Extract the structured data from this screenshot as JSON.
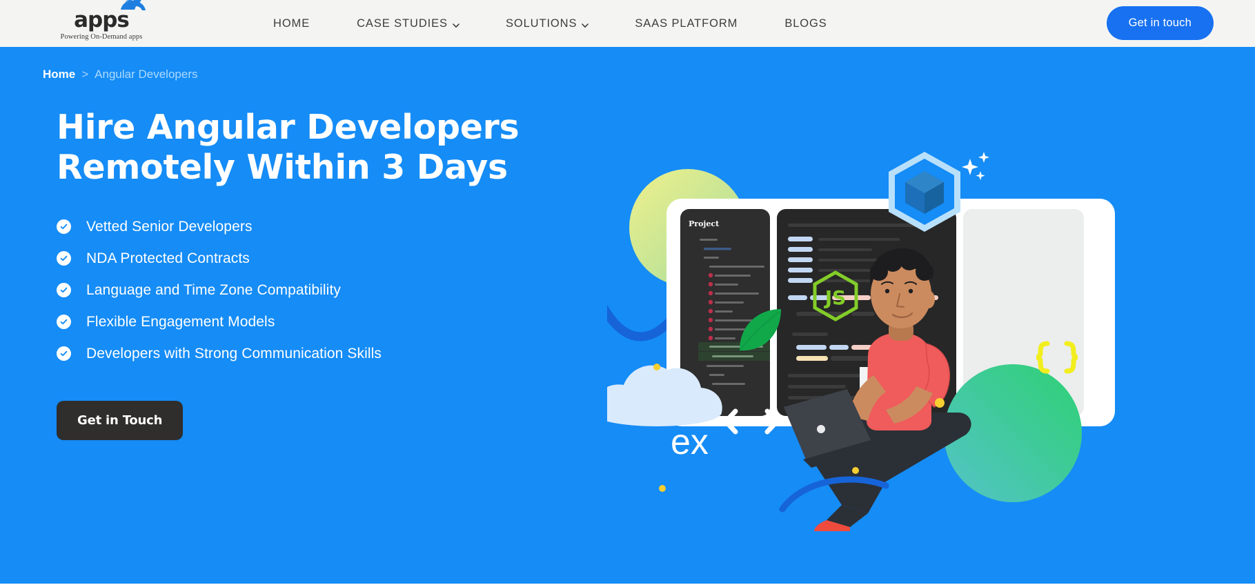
{
  "header": {
    "logo": {
      "word": "apps",
      "tagline": "Powering On-Demand apps",
      "mark": "rhino-logo-icon"
    },
    "nav": [
      {
        "label": "HOME",
        "has_dropdown": false
      },
      {
        "label": "CASE STUDIES",
        "has_dropdown": true
      },
      {
        "label": "SOLUTIONS",
        "has_dropdown": true
      },
      {
        "label": "SAAS PLATFORM",
        "has_dropdown": false
      },
      {
        "label": "BLOGS",
        "has_dropdown": false
      }
    ],
    "cta_label": "Get in touch",
    "background": "#f4f5f3",
    "cta_color": "#1771f1"
  },
  "hero": {
    "background": "#158cf6",
    "breadcrumb": {
      "home": "Home",
      "separator": ">",
      "current": "Angular Developers"
    },
    "title_line1": "Hire Angular Developers",
    "title_line2": "Remotely Within 3 Days",
    "bullets": [
      "Vetted Senior Developers",
      "NDA Protected Contracts",
      "Language and Time Zone Compatibility",
      "Flexible Engagement Models",
      "Developers with Strong Communication Skills"
    ],
    "cta_label": "Get in Touch",
    "cta_color": "#2f2e2c"
  },
  "illustration": {
    "editor_sidebar_title": "Project",
    "express_wordmark": "ex",
    "tech_badges": [
      "webpack-cube-icon",
      "nodejs-js-hexagon-icon",
      "angular-shield-icon",
      "js-file-badge-icon",
      "code-brackets-icon",
      "curly-braces-icon"
    ],
    "colors": {
      "editor_dark": "#2b2b2b",
      "laptop_body": "#3e4249",
      "shirt": "#f05b5b",
      "skin": "#cc8b5f",
      "hair": "#1d1d1f",
      "angular_red": "#dd1b16",
      "node_green": "#83cd29",
      "yellow_dot": "#f7cf31",
      "cloud": "#d9eafc",
      "green_circle_from": "#4ec3c7",
      "green_circle_to": "#2ed072",
      "lime_circle_from": "#e9ec8a",
      "lime_circle_to": "#9fdb9a"
    }
  }
}
